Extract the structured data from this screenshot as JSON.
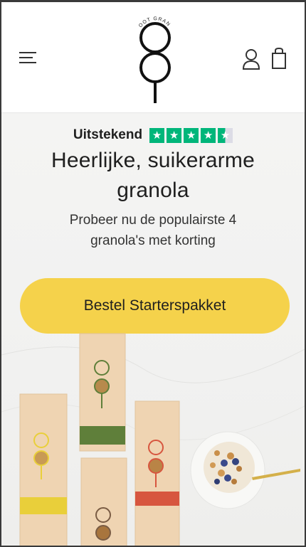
{
  "header": {
    "logo_text": "OOT GRANOLA",
    "menu_icon": "hamburger-menu-icon",
    "account_icon": "user-icon",
    "cart_icon": "shopping-bag-icon"
  },
  "hero": {
    "rating_label": "Uitstekend",
    "rating_stars": 4.5,
    "headline_line1": "Heerlijke, suikerarme",
    "headline_line2": "granola",
    "subline_line1": "Probeer nu de populairste 4",
    "subline_line2": "granola's met korting",
    "cta_label": "Bestel Starterspakket"
  },
  "colors": {
    "cta": "#f5d24b",
    "trustpilot_green": "#00b67a",
    "bag_yellow": "#e9cf3a",
    "bag_green": "#5f7f3a",
    "bag_red": "#d7563f",
    "bag_brown": "#7a5c44"
  }
}
